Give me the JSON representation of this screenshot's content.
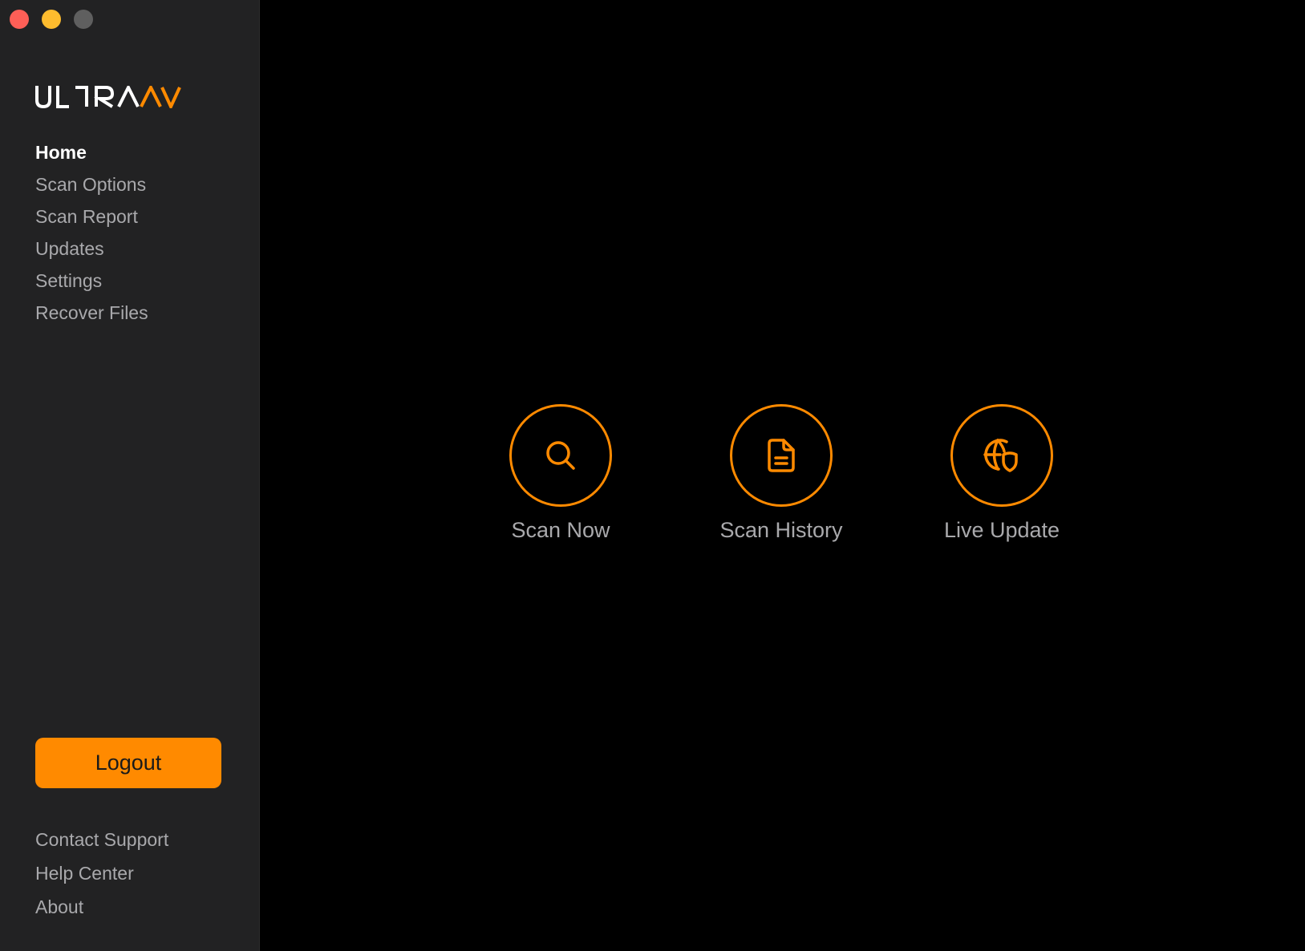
{
  "window": {
    "controls": [
      "close",
      "minimize",
      "maximize"
    ]
  },
  "brand": {
    "logo_text": "ULTRAAV",
    "logo_white_part": "ULTRA",
    "logo_accent_part": "AV",
    "accent_color": "#ff8a00"
  },
  "sidebar": {
    "nav_items": [
      {
        "label": "Home",
        "active": true
      },
      {
        "label": "Scan Options",
        "active": false
      },
      {
        "label": "Scan Report",
        "active": false
      },
      {
        "label": "Updates",
        "active": false
      },
      {
        "label": "Settings",
        "active": false
      },
      {
        "label": "Recover Files",
        "active": false
      }
    ],
    "logout_label": "Logout",
    "footer_links": [
      {
        "label": "Contact Support"
      },
      {
        "label": "Help Center"
      },
      {
        "label": "About"
      }
    ]
  },
  "main": {
    "actions": [
      {
        "label": "Scan Now",
        "icon": "search-icon"
      },
      {
        "label": "Scan History",
        "icon": "document-icon"
      },
      {
        "label": "Live Update",
        "icon": "globe-shield-icon"
      }
    ]
  },
  "colors": {
    "sidebar_bg": "#222223",
    "main_bg": "#000000",
    "text_muted": "#a9a9ac",
    "text_active": "#ffffff"
  }
}
